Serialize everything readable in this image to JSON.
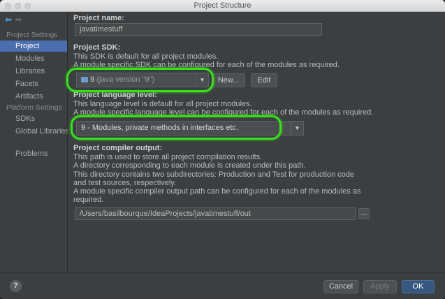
{
  "window": {
    "title": "Project Structure"
  },
  "sidebar": {
    "nav": {
      "back": "⬅",
      "forward": "➡"
    },
    "project_settings_header": "Project Settings",
    "project_items": [
      "Project",
      "Modules",
      "Libraries",
      "Facets",
      "Artifacts"
    ],
    "platform_settings_header": "Platform Settings",
    "platform_items": [
      "SDKs",
      "Global Libraries"
    ],
    "problems": "Problems"
  },
  "project_name": {
    "label": "Project name:",
    "value": "javatimestuff"
  },
  "project_sdk": {
    "label": "Project SDK:",
    "desc_line1": "This SDK is default for all project modules.",
    "desc_line2": "A module specific SDK can be configured for each of the modules as required.",
    "selected_number": "9",
    "selected_detail": "(java version \"9\")",
    "new_button": "New...",
    "edit_button": "Edit"
  },
  "language_level": {
    "label": "Project language level:",
    "desc_line1": "This language level is default for all project modules.",
    "desc_line2": "A module specific language level can be configured for each of the modules as required.",
    "selected": "9 - Modules, private methods in interfaces etc."
  },
  "compiler_output": {
    "label": "Project compiler output:",
    "lines": [
      "This path is used to store all project compilation results.",
      "A directory corresponding to each module is created under this path.",
      "This directory contains two subdirectories: Production and Test for production code",
      "and test sources, respectively.",
      "A module specific compiler output path can be configured for each of the modules as",
      "required."
    ],
    "path": "/Users/basilbourque/IdeaProjects/javatimestuff/out",
    "browse_button": "..."
  },
  "footer": {
    "help": "?",
    "cancel": "Cancel",
    "apply": "Apply",
    "ok": "OK"
  },
  "colors": {
    "highlight_ring": "#37e11a",
    "selection": "#4b6eaf",
    "ok_button": "#365880"
  }
}
